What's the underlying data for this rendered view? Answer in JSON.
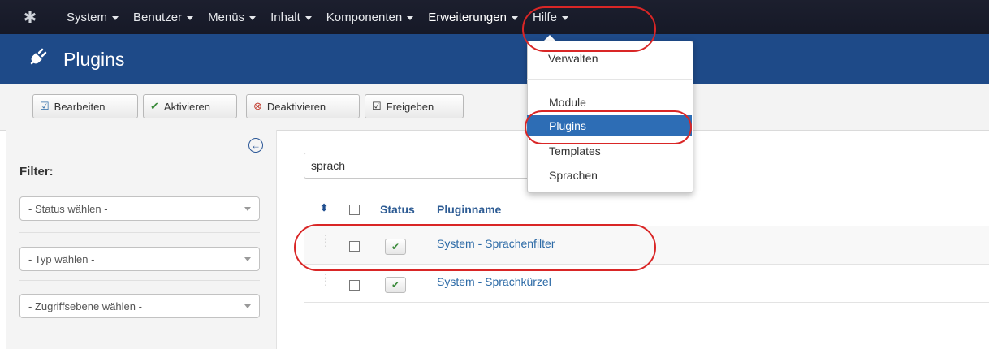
{
  "nav": {
    "items": [
      {
        "label": "System"
      },
      {
        "label": "Benutzer"
      },
      {
        "label": "Menüs"
      },
      {
        "label": "Inhalt"
      },
      {
        "label": "Komponenten"
      },
      {
        "label": "Erweiterungen"
      },
      {
        "label": "Hilfe"
      }
    ]
  },
  "header": {
    "title": "Plugins"
  },
  "toolbar": {
    "edit_label": "Bearbeiten",
    "enable_label": "Aktivieren",
    "disable_label": "Deaktivieren",
    "checkin_label": "Freigeben"
  },
  "sidebar": {
    "filter_label": "Filter:",
    "status_select": "- Status wählen -",
    "type_select": "- Typ wählen -",
    "access_select": "- Zugriffsebene wählen -"
  },
  "search": {
    "value": "sprach"
  },
  "table": {
    "headers": {
      "status": "Status",
      "name": "Pluginname"
    },
    "rows": [
      {
        "name": "System - Sprachenfilter",
        "enabled": true
      },
      {
        "name": "System - Sprachkürzel",
        "enabled": true
      }
    ]
  },
  "dropdown": {
    "items": [
      {
        "label": "Verwalten"
      },
      {
        "label": "Module"
      },
      {
        "label": "Plugins"
      },
      {
        "label": "Templates"
      },
      {
        "label": "Sprachen"
      }
    ]
  },
  "colors": {
    "nav_bg": "#1c1f2e",
    "header_bg": "#1e4a88",
    "highlight": "#d92626",
    "menu_active": "#2d6db5"
  }
}
